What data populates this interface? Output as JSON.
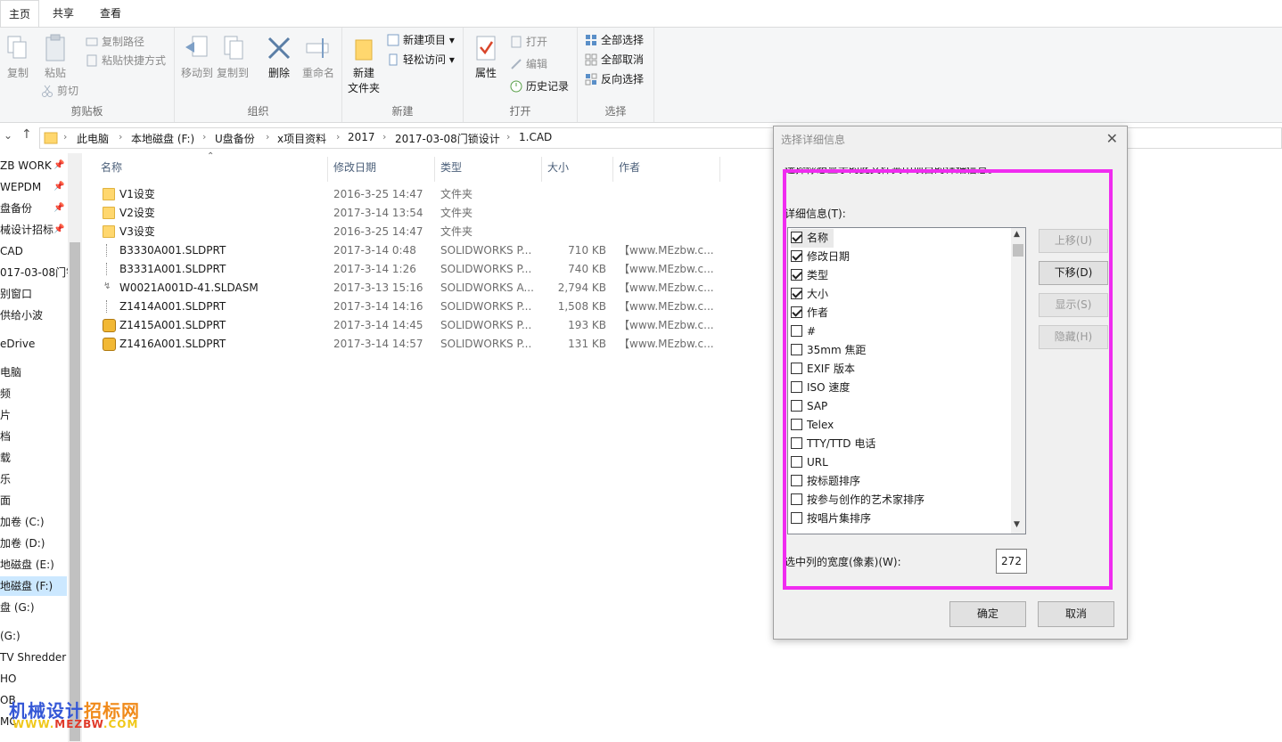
{
  "ribbon": {
    "tabs": [
      "主页",
      "共享",
      "查看"
    ],
    "clipboard": {
      "label": "剪贴板",
      "copy": "复制",
      "paste": "粘贴",
      "copy_path": "复制路径",
      "paste_shortcut": "粘贴快捷方式",
      "cut": "剪切"
    },
    "organize": {
      "label": "组织",
      "move_to": "移动到",
      "copy_to": "复制到",
      "delete": "删除",
      "rename": "重命名"
    },
    "new": {
      "label": "新建",
      "new_folder_l1": "新建",
      "new_folder_l2": "文件夹",
      "new_item": "新建项目",
      "easy_access": "轻松访问"
    },
    "open": {
      "label": "打开",
      "properties": "属性",
      "open": "打开",
      "edit": "编辑",
      "history": "历史记录"
    },
    "select": {
      "label": "选择",
      "select_all": "全部选择",
      "select_none": "全部取消",
      "invert": "反向选择"
    }
  },
  "breadcrumb": [
    "此电脑",
    "本地磁盘 (F:)",
    "U盘备份",
    "x项目资料",
    "2017",
    "2017-03-08门锁设计",
    "1.CAD"
  ],
  "nav": [
    "ZB WORK",
    "WEPDM",
    "盘备份",
    "械设计招标",
    "CAD",
    "017-03-08门锁",
    "别窗口",
    "供给小波",
    "eDrive",
    "电脑",
    "频",
    "片",
    "档",
    "载",
    "乐",
    "面",
    "加卷 (C:)",
    "加卷 (D:)",
    "地磁盘 (E:)",
    "地磁盘 (F:)",
    "盘 (G:)",
    "(G:)",
    "TV Shredder",
    "HO",
    "OB",
    "MC"
  ],
  "columns": {
    "name": "名称",
    "date": "修改日期",
    "type": "类型",
    "size": "大小",
    "author": "作者"
  },
  "files": [
    {
      "name": "V1设变",
      "date": "2016-3-25 14:47",
      "type": "文件夹",
      "size": "",
      "author": "",
      "kind": "folder"
    },
    {
      "name": "V2设变",
      "date": "2017-3-14 13:54",
      "type": "文件夹",
      "size": "",
      "author": "",
      "kind": "folder"
    },
    {
      "name": "V3设变",
      "date": "2016-3-25 14:47",
      "type": "文件夹",
      "size": "",
      "author": "",
      "kind": "folder"
    },
    {
      "name": "B3330A001.SLDPRT",
      "date": "2017-3-14 0:48",
      "type": "SOLIDWORKS P...",
      "size": "710 KB",
      "author": "【www.MEzbw.c...",
      "kind": "doc"
    },
    {
      "name": "B3331A001.SLDPRT",
      "date": "2017-3-14 1:26",
      "type": "SOLIDWORKS P...",
      "size": "740 KB",
      "author": "【www.MEzbw.c...",
      "kind": "doc"
    },
    {
      "name": "W0021A001D-41.SLDASM",
      "date": "2017-3-13 15:16",
      "type": "SOLIDWORKS A...",
      "size": "2,794 KB",
      "author": "【www.MEzbw.c...",
      "kind": "asm"
    },
    {
      "name": "Z1414A001.SLDPRT",
      "date": "2017-3-14 14:16",
      "type": "SOLIDWORKS P...",
      "size": "1,508 KB",
      "author": "【www.MEzbw.c...",
      "kind": "doc"
    },
    {
      "name": "Z1415A001.SLDPRT",
      "date": "2017-3-14 14:45",
      "type": "SOLIDWORKS P...",
      "size": "193 KB",
      "author": "【www.MEzbw.c...",
      "kind": "sw"
    },
    {
      "name": "Z1416A001.SLDPRT",
      "date": "2017-3-14 14:57",
      "type": "SOLIDWORKS P...",
      "size": "131 KB",
      "author": "【www.MEzbw.c...",
      "kind": "sw"
    }
  ],
  "dialog": {
    "title": "选择详细信息",
    "description": "选择你想显示的此文件夹中项目的详细信息。",
    "details_label": "详细信息(T):",
    "items": [
      {
        "label": "名称",
        "checked": true
      },
      {
        "label": "修改日期",
        "checked": true
      },
      {
        "label": "类型",
        "checked": true
      },
      {
        "label": "大小",
        "checked": true
      },
      {
        "label": "作者",
        "checked": true
      },
      {
        "label": "#",
        "checked": false
      },
      {
        "label": "35mm 焦距",
        "checked": false
      },
      {
        "label": "EXIF 版本",
        "checked": false
      },
      {
        "label": "ISO 速度",
        "checked": false
      },
      {
        "label": "SAP",
        "checked": false
      },
      {
        "label": "Telex",
        "checked": false
      },
      {
        "label": "TTY/TTD 电话",
        "checked": false
      },
      {
        "label": "URL",
        "checked": false
      },
      {
        "label": "按标题排序",
        "checked": false
      },
      {
        "label": "按参与创作的艺术家排序",
        "checked": false
      },
      {
        "label": "按唱片集排序",
        "checked": false
      }
    ],
    "move_up": "上移(U)",
    "move_down": "下移(D)",
    "show": "显示(S)",
    "hide": "隐藏(H)",
    "width_label": "选中列的宽度(像素)(W):",
    "width_value": "272",
    "ok": "确定",
    "cancel": "取消"
  },
  "watermark": {
    "line1_blue": "机械设计",
    "line1_orange": "招标网",
    "line2_yellow": "WWW.",
    "line2_red": "MEZBW",
    "line2_yellow2": ".COM"
  },
  "colors": {
    "highlight": "#f02cf0",
    "selection": "#cce8ff",
    "folder": "#ffd76e"
  }
}
